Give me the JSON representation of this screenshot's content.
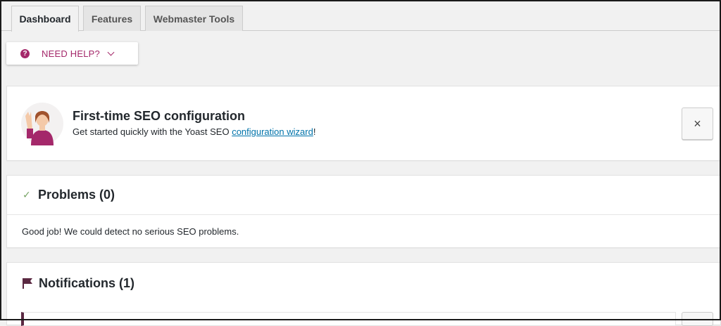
{
  "tabs": [
    {
      "label": "Dashboard"
    },
    {
      "label": "Features"
    },
    {
      "label": "Webmaster Tools"
    }
  ],
  "help": {
    "label": "NEED HELP?",
    "icon": "?"
  },
  "config": {
    "title": "First-time SEO configuration",
    "desc_before": "Get started quickly with the Yoast SEO ",
    "link": "configuration wizard",
    "desc_after": "!",
    "close_icon": "×"
  },
  "problems": {
    "title": "Problems (0)",
    "icon": "✓",
    "message": "Good job! We could detect no serious SEO problems."
  },
  "notifications": {
    "title": "Notifications (1)"
  },
  "colors": {
    "brand": "#a4286a",
    "link": "#0073aa",
    "check": "#77a464",
    "flag": "#5b2942"
  }
}
